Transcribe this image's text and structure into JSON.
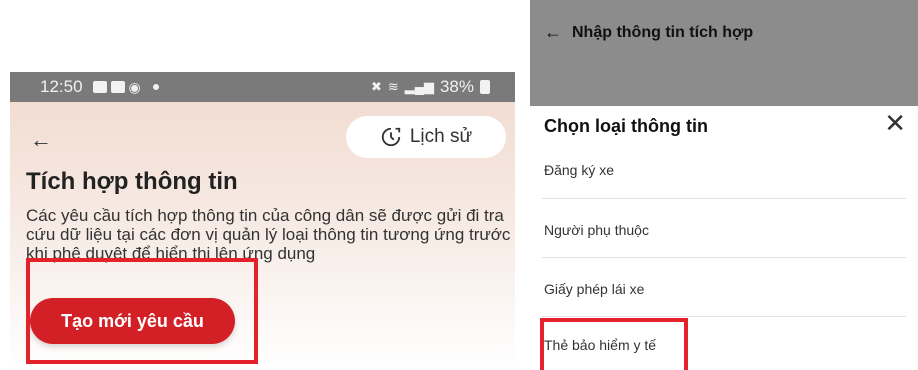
{
  "left_screen": {
    "status_bar": {
      "time": "12:50",
      "battery": "38%"
    },
    "history_button": {
      "label": "Lịch sử"
    },
    "page_title": "Tích hợp thông tin",
    "description": "Các yêu cầu tích hợp thông tin của công dân sẽ được gửi đi tra cứu dữ liệu tại các đơn vị quản lý loại thông tin tương ứng trước khi phê duyệt để hiển thị lên ứng dụng",
    "create_button": {
      "label": "Tạo mới yêu cầu"
    }
  },
  "right_screen": {
    "top_bar": {
      "title": "Nhập thông tin tích hợp"
    },
    "sheet": {
      "title": "Chọn loại thông tin",
      "options": [
        "Đăng ký xe",
        "Người phụ thuộc",
        "Giấy phép lái xe",
        "Thẻ bảo hiểm y tế"
      ]
    }
  },
  "colors": {
    "accent_red": "#d32027",
    "highlight_red": "#e3222b",
    "status_bar_gray": "#7a7a7a",
    "top_bar_gray": "#8c8c8c"
  },
  "icons": [
    "back-arrow-icon",
    "history-icon",
    "close-icon",
    "gallery-icon",
    "message-icon",
    "messenger-icon",
    "wifi-icon",
    "signal-icon",
    "battery-icon",
    "mute-icon"
  ]
}
